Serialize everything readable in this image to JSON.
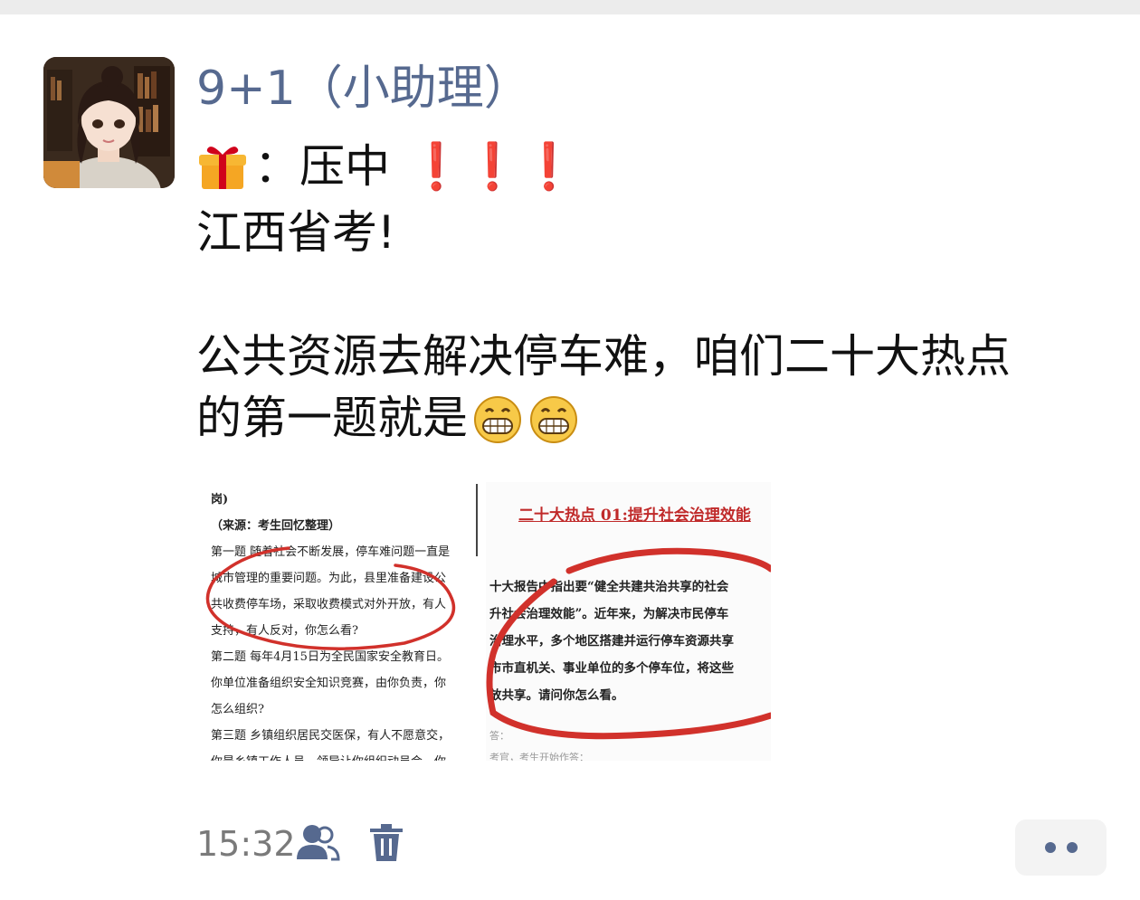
{
  "message": {
    "sender_name": "9+1（小助理）",
    "line1_prefix": "：压中",
    "line1_exclaim": "❗❗❗",
    "line2": "江西省考!",
    "line3": "公共资源去解决停车难，咱们二十大热点",
    "line4": "的第一题就是",
    "icons": [
      "gift-emoji",
      "grin-emoji",
      "grin-emoji"
    ]
  },
  "attachment": {
    "left_doc": [
      "岗)",
      "（来源：考生回忆整理）",
      "第一题  随着社会不断发展，停车难问题一直是",
      "城市管理的重要问题。为此，县里准备建设公",
      "共收费停车场，采取收费模式对外开放，有人",
      "支持，有人反对，你怎么看?",
      "第二题  每年4月15日为全民国家安全教育日。",
      "你单位准备组织安全知识竞赛，由你负责，你",
      "怎么组织?",
      "第三题  乡镇组织居民交医保，有人不愿意交，",
      "你是乡镇工作人员，领导让你组织动员会，你"
    ],
    "right_title": "二十大热点 01:提升社会治理效能",
    "right_doc": [
      "十大报告中指出要“健全共建共治共享的社会",
      "升社会治理效能”。近年来，为解决市民停车",
      "治理水平，多个地区搭建并运行停车资源共享",
      "市市直机关、事业单位的多个停车位，将这些",
      "放共享。请问你怎么看。"
    ],
    "right_footer": [
      "答：",
      "考官，考生开始作答："
    ]
  },
  "footer": {
    "time": "15:32",
    "icons": [
      "people-icon",
      "trash-icon",
      "more-icon"
    ]
  },
  "colors": {
    "name": "#56698f",
    "exclaim": "#e0201c",
    "ink": "#d1312b"
  }
}
